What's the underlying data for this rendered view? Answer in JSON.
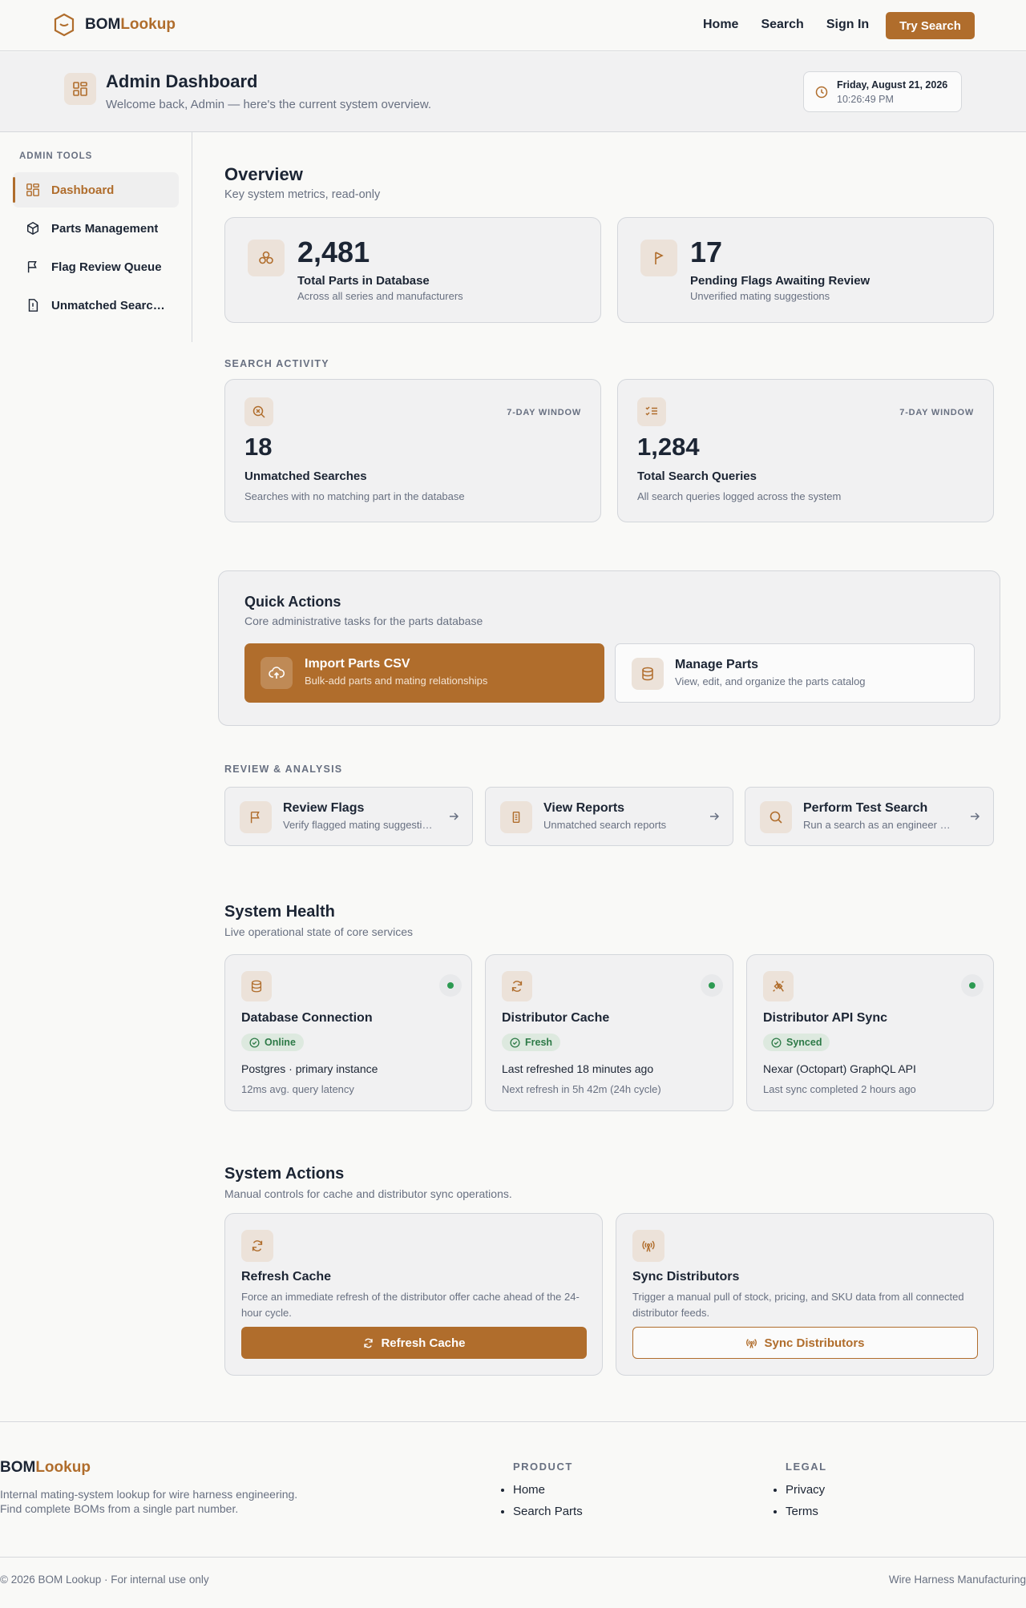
{
  "brand": {
    "part1": "BOM",
    "part2": "Lookup"
  },
  "nav": {
    "home": "Home",
    "search": "Search",
    "sign_in": "Sign In",
    "try_search": "Try Search"
  },
  "header": {
    "title": "Admin Dashboard",
    "subtitle": "Welcome back, Admin — here's the current system overview.",
    "date": "Friday, August 21, 2026",
    "time": "10:26:49 PM"
  },
  "sidebar": {
    "heading": "ADMIN TOOLS",
    "items": [
      {
        "label": "Dashboard",
        "icon": "dashboard-icon"
      },
      {
        "label": "Parts Management",
        "icon": "box-icon"
      },
      {
        "label": "Flag Review Queue",
        "icon": "flag-icon"
      },
      {
        "label": "Unmatched Searches",
        "icon": "file-alert-icon"
      }
    ]
  },
  "overview": {
    "title": "Overview",
    "subtitle": "Key system metrics, read-only",
    "cards": [
      {
        "value": "2,481",
        "label": "Total Parts in Database",
        "sub": "Across all series and manufacturers"
      },
      {
        "value": "17",
        "label": "Pending Flags Awaiting Review",
        "sub": "Unverified mating suggestions"
      }
    ]
  },
  "search_activity": {
    "caption": "SEARCH ACTIVITY",
    "cards": [
      {
        "window": "7-DAY WINDOW",
        "value": "18",
        "label": "Unmatched Searches",
        "sub": "Searches with no matching part in the database"
      },
      {
        "window": "7-DAY WINDOW",
        "value": "1,284",
        "label": "Total Search Queries",
        "sub": "All search queries logged across the system"
      }
    ]
  },
  "quick_actions": {
    "title": "Quick Actions",
    "subtitle": "Core administrative tasks for the parts database",
    "import": {
      "label": "Import Parts CSV",
      "sub": "Bulk-add parts and mating relationships"
    },
    "manage": {
      "label": "Manage Parts",
      "sub": "View, edit, and organize the parts catalog"
    }
  },
  "review": {
    "caption": "REVIEW & ANALYSIS",
    "items": [
      {
        "label": "Review Flags",
        "sub": "Verify flagged mating suggestions"
      },
      {
        "label": "View Reports",
        "sub": "Unmatched search reports"
      },
      {
        "label": "Perform Test Search",
        "sub": "Run a search as an engineer would"
      }
    ]
  },
  "health": {
    "title": "System Health",
    "subtitle": "Live operational state of core services",
    "cards": [
      {
        "title": "Database Connection",
        "status": "Online",
        "detail": "Postgres · primary instance",
        "meta": "12ms avg. query latency"
      },
      {
        "title": "Distributor Cache",
        "status": "Fresh",
        "detail": "Last refreshed 18 minutes ago",
        "meta": "Next refresh in 5h 42m (24h cycle)"
      },
      {
        "title": "Distributor API Sync",
        "status": "Synced",
        "detail": "Nexar (Octopart) GraphQL API",
        "meta": "Last sync completed 2 hours ago"
      }
    ],
    "status_color": "#2d9a52"
  },
  "system_actions": {
    "title": "System Actions",
    "subtitle": "Manual controls for cache and distributor sync operations.",
    "refresh": {
      "title": "Refresh Cache",
      "desc": "Force an immediate refresh of the distributor offer cache ahead of the 24-hour cycle.",
      "button": "Refresh Cache"
    },
    "sync": {
      "title": "Sync Distributors",
      "desc": "Trigger a manual pull of stock, pricing, and SKU data from all connected distributor feeds.",
      "button": "Sync Distributors"
    }
  },
  "footer": {
    "tagline1": "Internal mating-system lookup for wire harness engineering.",
    "tagline2": "Find complete BOMs from a single part number.",
    "product_heading": "PRODUCT",
    "product_links": [
      "Home",
      "Search Parts"
    ],
    "legal_heading": "LEGAL",
    "legal_links": [
      "Privacy",
      "Terms"
    ],
    "copyright": "© 2026 BOM Lookup · For internal use only",
    "right": "Wire Harness Manufacturing"
  },
  "colors": {
    "accent": "#b06d2c",
    "text": "#1c2534",
    "muted": "#687081",
    "success": "#2d9a52"
  }
}
